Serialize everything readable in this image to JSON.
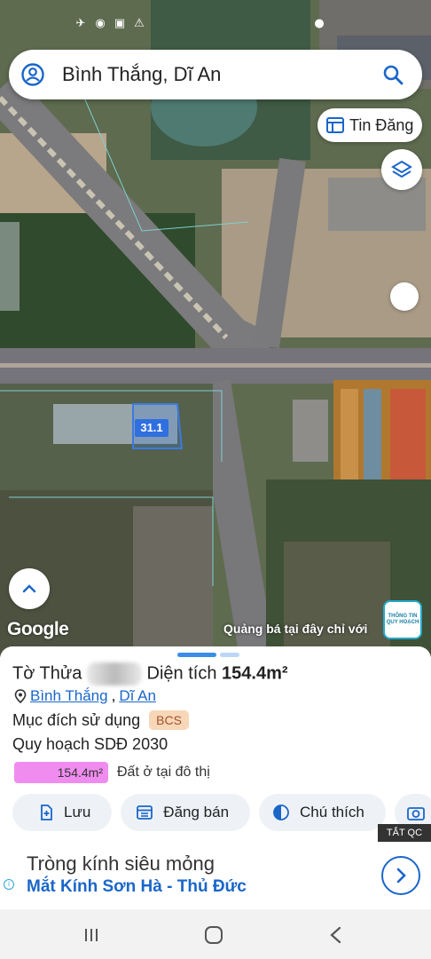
{
  "search": {
    "query": "Bình Thắng, Dĩ An"
  },
  "map": {
    "tin_dang_label": "Tin Đăng",
    "lot_label": "31.1",
    "google_label": "Google",
    "ad_text": "Quảng bá tại đây chỉ với",
    "ad_logo_line1": "THÔNG TIN",
    "ad_logo_line2": "QUY HOẠCH"
  },
  "sheet": {
    "title_prefix": "Tờ",
    "title_mid": "Thửa",
    "title_area_label": "Diện tích",
    "title_area_value": "154.4m²",
    "location_ward": "Bình Thắng",
    "location_sep": ",",
    "location_city": "Dĩ An",
    "purpose_label": "Mục đích sử dụng",
    "purpose_badge": "BCS",
    "planning_label": "Quy hoạch SDĐ 2030",
    "legend_value": "154.4m²",
    "legend_label": "Đất ở tại đô thị",
    "legend_color": "#f08cf0",
    "actions": [
      {
        "label": "Lưu",
        "icon": "bookmark-add-icon"
      },
      {
        "label": "Đăng bán",
        "icon": "listing-icon"
      },
      {
        "label": "Chú thích",
        "icon": "legend-icon"
      }
    ]
  },
  "ad": {
    "close_label": "TẮT QC",
    "headline": "Tròng kính siêu mỏng",
    "advertiser": "Mắt Kính Sơn Hà - Thủ Đức"
  },
  "colors": {
    "accent": "#1a66c9",
    "badge_bg": "#f8d7b8",
    "lot_blue": "#2f6fe0"
  }
}
